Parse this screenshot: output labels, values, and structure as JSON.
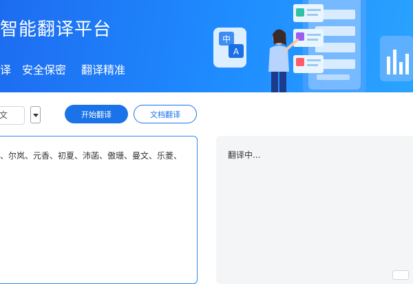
{
  "header": {
    "title": "智能翻译平台",
    "features": [
      "译",
      "安全保密",
      "翻译精准"
    ]
  },
  "illustration": {
    "badge_zh": "中",
    "badge_en": "A"
  },
  "toolbar": {
    "source_lang_value": "文",
    "start_label": "开始翻译",
    "doc_label": "文档翻译"
  },
  "source": {
    "text": "、尔岚、元香、初夏、沛菡、傲珊、曼文、乐菱、"
  },
  "target": {
    "status": "翻译中..."
  }
}
